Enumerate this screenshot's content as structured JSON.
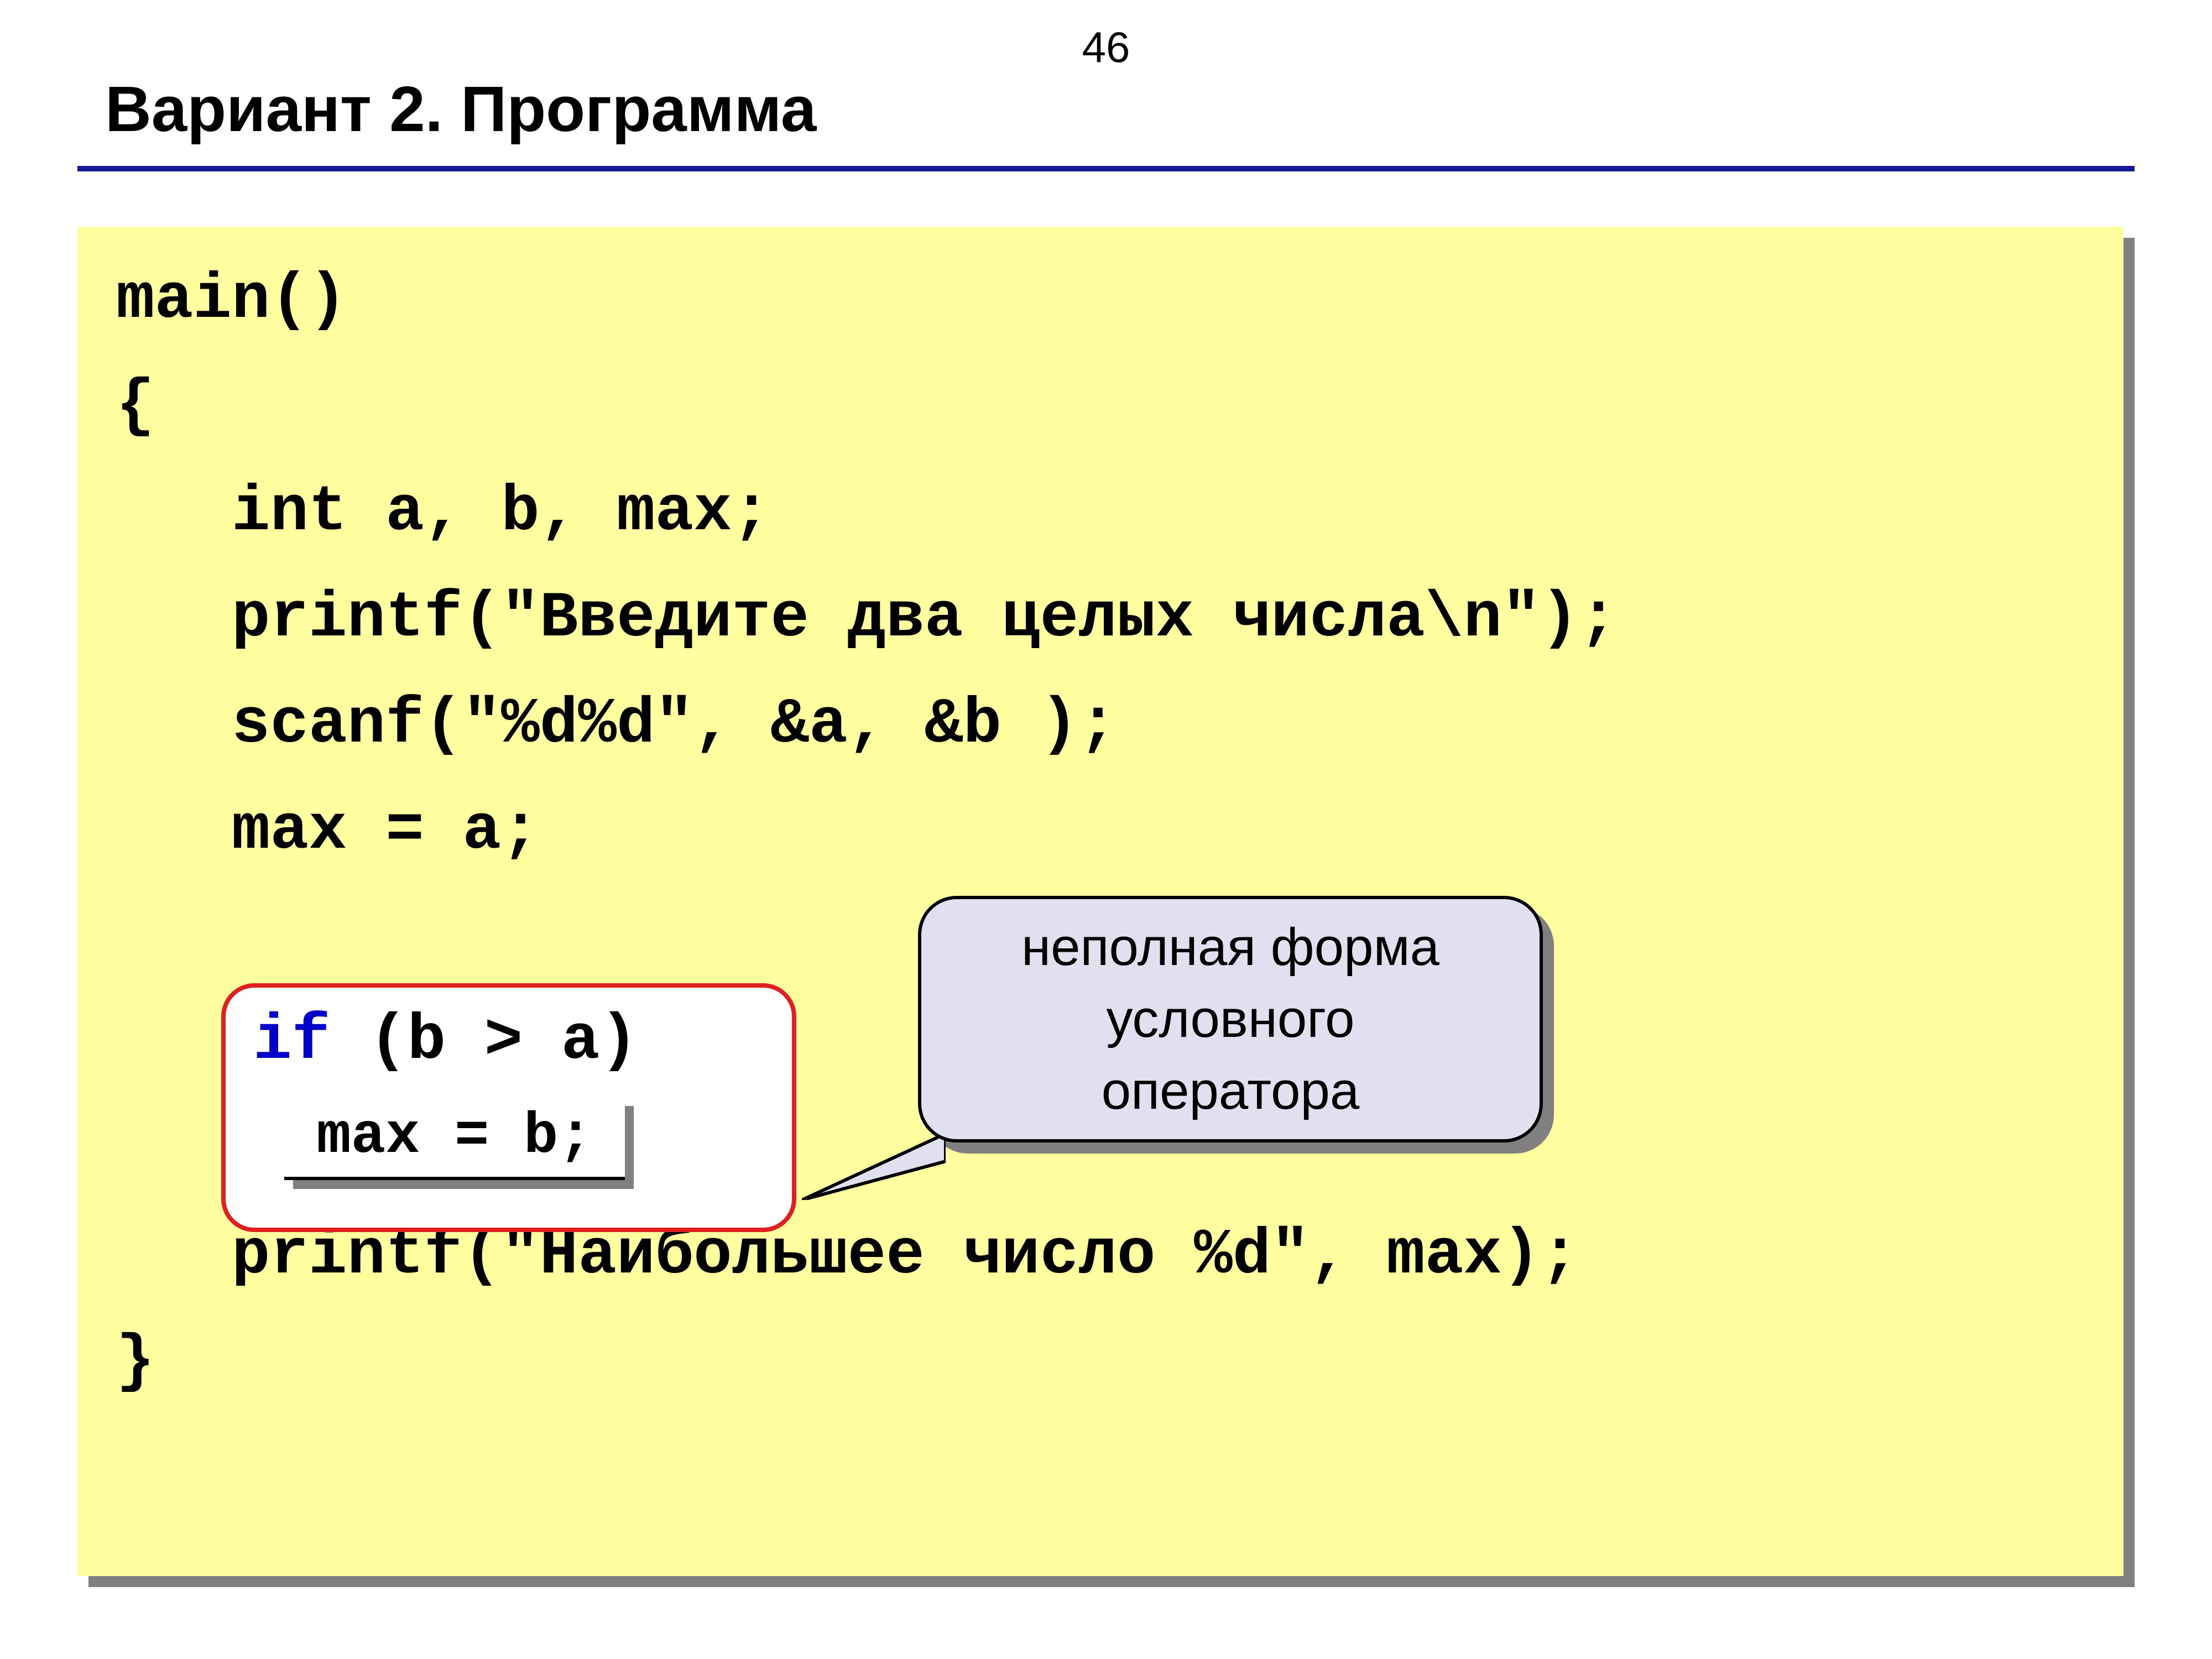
{
  "page_number": "46",
  "title": "Вариант 2. Программа",
  "code": {
    "l1": "main()",
    "l2": "{",
    "l3": "   int a, b, max;",
    "l4": "   printf(\"Введите два целых числа\\n\");",
    "l5": "   scanf(\"%d%d\", &a, &b );",
    "l6": "   max = a;",
    "if_kw": "if",
    "if_cond": " (b > a)",
    "l10": "   printf(\"Наибольшее число %d\", max);",
    "l11": "}"
  },
  "maxb": "max = b;",
  "callout": "неполная форма\nусловного\nоператора"
}
